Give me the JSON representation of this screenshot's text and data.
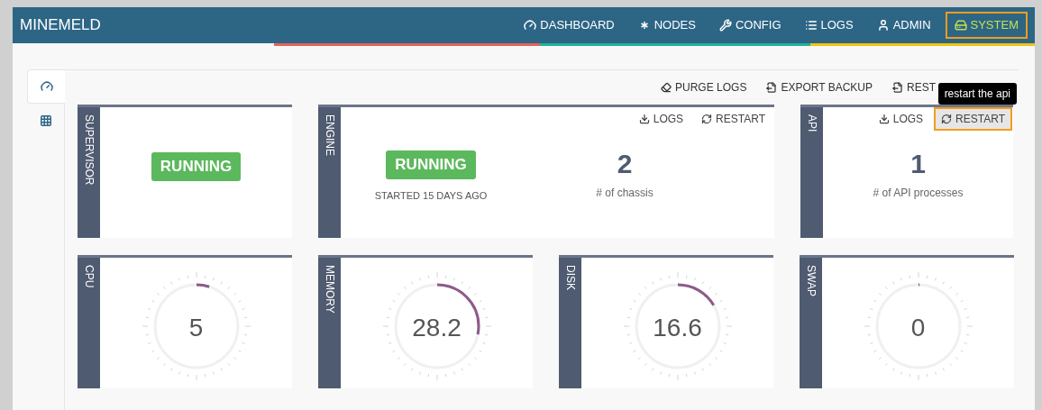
{
  "navbar": {
    "brand": "MINEMELD",
    "items": [
      {
        "label": "DASHBOARD",
        "selected": false
      },
      {
        "label": "NODES",
        "selected": false
      },
      {
        "label": "CONFIG",
        "selected": false
      },
      {
        "label": "LOGS",
        "selected": false
      },
      {
        "label": "ADMIN",
        "selected": false
      },
      {
        "label": "SYSTEM",
        "selected": true
      }
    ]
  },
  "side_tabs": [
    {
      "selected": true
    },
    {
      "selected": false
    }
  ],
  "toolbar": [
    {
      "label": "PURGE LOGS"
    },
    {
      "label": "EXPORT BACKUP"
    },
    {
      "label": "REST"
    }
  ],
  "tooltip": "restart the api",
  "status_cards": [
    {
      "title": "SUPERVISOR",
      "status": "RUNNING"
    },
    {
      "title": "ENGINE",
      "status": "RUNNING",
      "subtitle": "STARTED 15 DAYS AGO",
      "count": "2",
      "count_label": "# of chassis",
      "actions": [
        {
          "label": "LOGS",
          "highlighted": false
        },
        {
          "label": "RESTART",
          "highlighted": false
        }
      ]
    },
    {
      "title": "API",
      "count": "1",
      "count_label": "# of API processes",
      "actions": [
        {
          "label": "LOGS",
          "highlighted": false
        },
        {
          "label": "RESTART",
          "highlighted": true
        }
      ]
    }
  ],
  "gauges": [
    {
      "title": "CPU",
      "reading": "5",
      "level": 0.05
    },
    {
      "title": "MEMORY",
      "reading": "28.2",
      "level": 0.282
    },
    {
      "title": "DISK",
      "reading": "16.6",
      "level": 0.166
    },
    {
      "title": "SWAP",
      "reading": "0",
      "level": 0
    }
  ]
}
